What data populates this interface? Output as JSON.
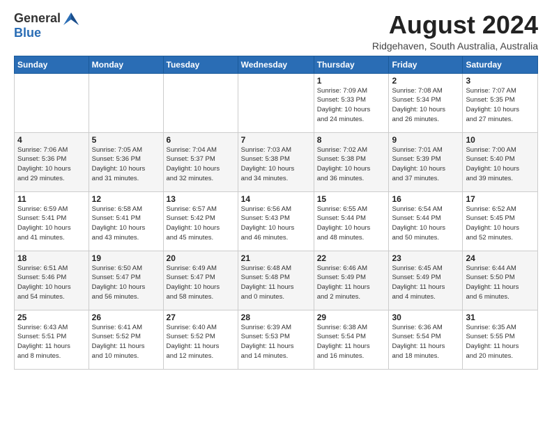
{
  "header": {
    "logo_general": "General",
    "logo_blue": "Blue",
    "month_year": "August 2024",
    "location": "Ridgehaven, South Australia, Australia"
  },
  "weekdays": [
    "Sunday",
    "Monday",
    "Tuesday",
    "Wednesday",
    "Thursday",
    "Friday",
    "Saturday"
  ],
  "weeks": [
    [
      {
        "day": "",
        "info": ""
      },
      {
        "day": "",
        "info": ""
      },
      {
        "day": "",
        "info": ""
      },
      {
        "day": "",
        "info": ""
      },
      {
        "day": "1",
        "info": "Sunrise: 7:09 AM\nSunset: 5:33 PM\nDaylight: 10 hours\nand 24 minutes."
      },
      {
        "day": "2",
        "info": "Sunrise: 7:08 AM\nSunset: 5:34 PM\nDaylight: 10 hours\nand 26 minutes."
      },
      {
        "day": "3",
        "info": "Sunrise: 7:07 AM\nSunset: 5:35 PM\nDaylight: 10 hours\nand 27 minutes."
      }
    ],
    [
      {
        "day": "4",
        "info": "Sunrise: 7:06 AM\nSunset: 5:36 PM\nDaylight: 10 hours\nand 29 minutes."
      },
      {
        "day": "5",
        "info": "Sunrise: 7:05 AM\nSunset: 5:36 PM\nDaylight: 10 hours\nand 31 minutes."
      },
      {
        "day": "6",
        "info": "Sunrise: 7:04 AM\nSunset: 5:37 PM\nDaylight: 10 hours\nand 32 minutes."
      },
      {
        "day": "7",
        "info": "Sunrise: 7:03 AM\nSunset: 5:38 PM\nDaylight: 10 hours\nand 34 minutes."
      },
      {
        "day": "8",
        "info": "Sunrise: 7:02 AM\nSunset: 5:38 PM\nDaylight: 10 hours\nand 36 minutes."
      },
      {
        "day": "9",
        "info": "Sunrise: 7:01 AM\nSunset: 5:39 PM\nDaylight: 10 hours\nand 37 minutes."
      },
      {
        "day": "10",
        "info": "Sunrise: 7:00 AM\nSunset: 5:40 PM\nDaylight: 10 hours\nand 39 minutes."
      }
    ],
    [
      {
        "day": "11",
        "info": "Sunrise: 6:59 AM\nSunset: 5:41 PM\nDaylight: 10 hours\nand 41 minutes."
      },
      {
        "day": "12",
        "info": "Sunrise: 6:58 AM\nSunset: 5:41 PM\nDaylight: 10 hours\nand 43 minutes."
      },
      {
        "day": "13",
        "info": "Sunrise: 6:57 AM\nSunset: 5:42 PM\nDaylight: 10 hours\nand 45 minutes."
      },
      {
        "day": "14",
        "info": "Sunrise: 6:56 AM\nSunset: 5:43 PM\nDaylight: 10 hours\nand 46 minutes."
      },
      {
        "day": "15",
        "info": "Sunrise: 6:55 AM\nSunset: 5:44 PM\nDaylight: 10 hours\nand 48 minutes."
      },
      {
        "day": "16",
        "info": "Sunrise: 6:54 AM\nSunset: 5:44 PM\nDaylight: 10 hours\nand 50 minutes."
      },
      {
        "day": "17",
        "info": "Sunrise: 6:52 AM\nSunset: 5:45 PM\nDaylight: 10 hours\nand 52 minutes."
      }
    ],
    [
      {
        "day": "18",
        "info": "Sunrise: 6:51 AM\nSunset: 5:46 PM\nDaylight: 10 hours\nand 54 minutes."
      },
      {
        "day": "19",
        "info": "Sunrise: 6:50 AM\nSunset: 5:47 PM\nDaylight: 10 hours\nand 56 minutes."
      },
      {
        "day": "20",
        "info": "Sunrise: 6:49 AM\nSunset: 5:47 PM\nDaylight: 10 hours\nand 58 minutes."
      },
      {
        "day": "21",
        "info": "Sunrise: 6:48 AM\nSunset: 5:48 PM\nDaylight: 11 hours\nand 0 minutes."
      },
      {
        "day": "22",
        "info": "Sunrise: 6:46 AM\nSunset: 5:49 PM\nDaylight: 11 hours\nand 2 minutes."
      },
      {
        "day": "23",
        "info": "Sunrise: 6:45 AM\nSunset: 5:49 PM\nDaylight: 11 hours\nand 4 minutes."
      },
      {
        "day": "24",
        "info": "Sunrise: 6:44 AM\nSunset: 5:50 PM\nDaylight: 11 hours\nand 6 minutes."
      }
    ],
    [
      {
        "day": "25",
        "info": "Sunrise: 6:43 AM\nSunset: 5:51 PM\nDaylight: 11 hours\nand 8 minutes."
      },
      {
        "day": "26",
        "info": "Sunrise: 6:41 AM\nSunset: 5:52 PM\nDaylight: 11 hours\nand 10 minutes."
      },
      {
        "day": "27",
        "info": "Sunrise: 6:40 AM\nSunset: 5:52 PM\nDaylight: 11 hours\nand 12 minutes."
      },
      {
        "day": "28",
        "info": "Sunrise: 6:39 AM\nSunset: 5:53 PM\nDaylight: 11 hours\nand 14 minutes."
      },
      {
        "day": "29",
        "info": "Sunrise: 6:38 AM\nSunset: 5:54 PM\nDaylight: 11 hours\nand 16 minutes."
      },
      {
        "day": "30",
        "info": "Sunrise: 6:36 AM\nSunset: 5:54 PM\nDaylight: 11 hours\nand 18 minutes."
      },
      {
        "day": "31",
        "info": "Sunrise: 6:35 AM\nSunset: 5:55 PM\nDaylight: 11 hours\nand 20 minutes."
      }
    ]
  ]
}
